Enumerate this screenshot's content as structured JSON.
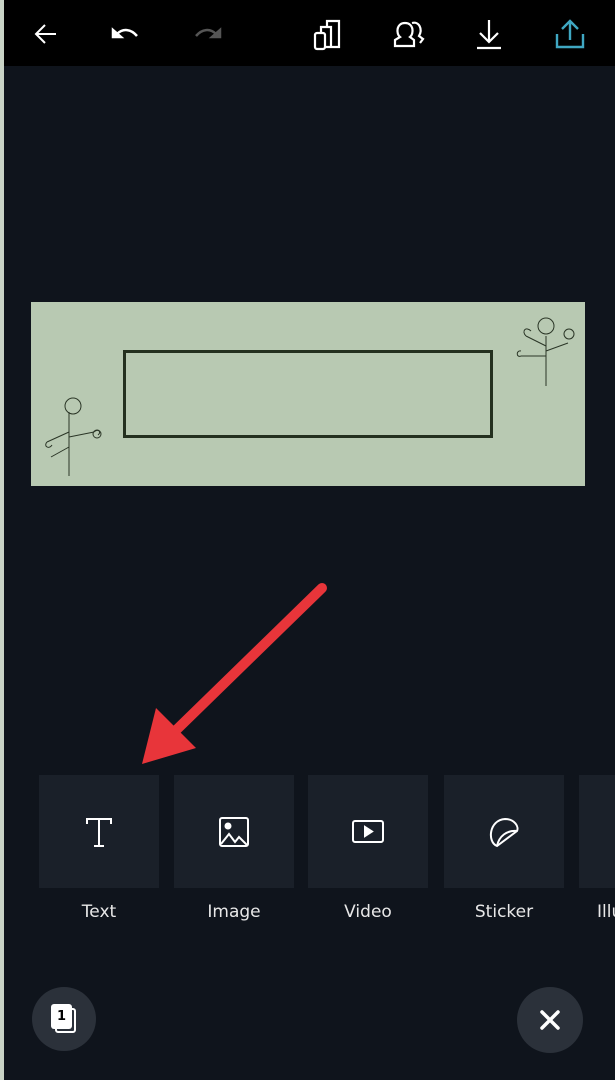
{
  "toolbar": {
    "icons": [
      "back-arrow-icon",
      "undo-icon",
      "redo-icon",
      "resize-icon",
      "share-people-icon",
      "download-icon",
      "publish-icon"
    ],
    "publish_color": "#3fa7c2"
  },
  "canvas": {
    "background": "#b8c9b2"
  },
  "elements": [
    {
      "label": "Text",
      "icon": "text-icon"
    },
    {
      "label": "Image",
      "icon": "image-icon"
    },
    {
      "label": "Video",
      "icon": "video-icon"
    },
    {
      "label": "Sticker",
      "icon": "sticker-icon"
    },
    {
      "label": "Illu",
      "icon": "illustration-icon"
    }
  ],
  "pages": {
    "count": "1"
  },
  "annotation": {
    "arrow_color": "#e8353a"
  }
}
